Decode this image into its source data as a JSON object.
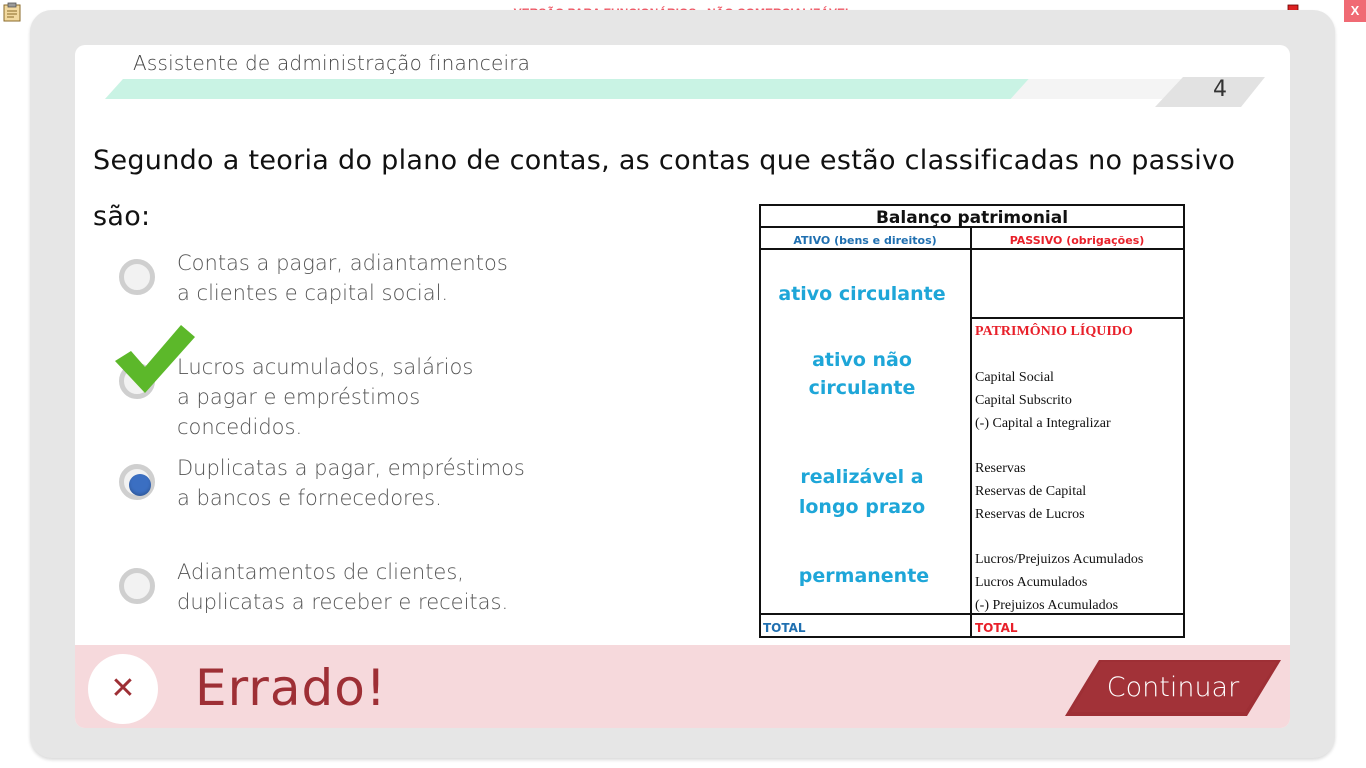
{
  "window": {
    "banner": "VERSÃO PARA FUNCIONÁRIOS - NÃO COMERCIALIZÁVEL",
    "close_label": "X"
  },
  "header": {
    "title": "Assistente de administração financeira",
    "page_number": "4",
    "progress_fraction": 0.8
  },
  "question": {
    "text": "Segundo a teoria do plano de contas, as contas que estão classificadas no passivo são:"
  },
  "options": [
    {
      "line1": "Contas a pagar, adiantamentos",
      "line2": "a clientes e capital social.",
      "state": "unselected"
    },
    {
      "line1": "Lucros acumulados, salários",
      "line2": "a pagar e empréstimos concedidos.",
      "state": "correct"
    },
    {
      "line1": "Duplicatas a pagar, empréstimos",
      "line2": "a bancos e fornecedores.",
      "state": "selected"
    },
    {
      "line1": "Adiantamentos de clientes,",
      "line2": "duplicatas a receber e receitas.",
      "state": "unselected"
    }
  ],
  "balance_sheet": {
    "title": "Balanço patrimonial",
    "ativo_header": "ATIVO (bens e direitos)",
    "passivo_header": "PASSIVO (obrigações)",
    "ativo_circulante": "ativo circulante",
    "ativo_nao_circulante_1": "ativo não",
    "ativo_nao_circulante_2": "circulante",
    "realizavel_1": "realizável a",
    "realizavel_2": "longo prazo",
    "permanente": "permanente",
    "patrimonio_liquido": "PATRIMÔNIO LÍQUIDO",
    "pl_items": [
      "Capital Social",
      "Capital Subscrito",
      "(-) Capital a Integralizar",
      "Reservas",
      "Reservas de Capital",
      "Reservas de Lucros",
      "Lucros/Prejuizos Acumulados",
      "Lucros Acumulados",
      "(-) Prejuizos Acumulados"
    ],
    "total_left": "TOTAL",
    "total_right": "TOTAL"
  },
  "feedback": {
    "icon_label": "✕",
    "text": "Errado!",
    "continue_label": "Continuar"
  },
  "colors": {
    "banner": "#ef5a67",
    "progress_fill": "#c9f3e4",
    "feedback_bg": "#f6d9dc",
    "feedback_text": "#9e2f35",
    "radio_selected": "#3b6fc2",
    "check": "#5cb82a",
    "ativo_blue": "#1ea6d8",
    "passivo_red": "#e8202a"
  }
}
